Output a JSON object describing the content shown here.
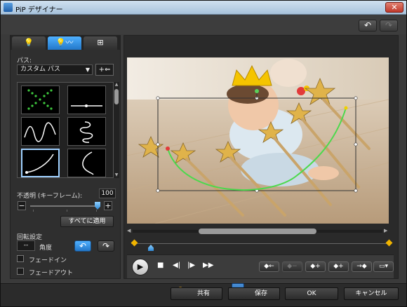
{
  "window": {
    "title": "PiP デザイナー",
    "close_glyph": "✕"
  },
  "toolbar": {
    "undo_glyph": "↶",
    "redo_glyph": "↷"
  },
  "tabs": [
    {
      "icon": "lightbulb-icon",
      "glyph": "💡"
    },
    {
      "icon": "motion-path-icon",
      "glyph": "💡〰"
    },
    {
      "icon": "grid-icon",
      "glyph": "⊞"
    }
  ],
  "path": {
    "label": "パス:",
    "selected": "カスタム パス",
    "add_glyph": "+⇐"
  },
  "opacity": {
    "label": "不透明 (キーフレーム):",
    "value": "100",
    "minus": "−",
    "plus": "+",
    "level": 1.0
  },
  "apply_all": "すべてに適用",
  "rotation": {
    "label": "回転設定",
    "value": "--",
    "unit": "角度",
    "ccw_glyph": "↶",
    "cw_glyph": "↷"
  },
  "fade_in": {
    "label": "フェードイン",
    "checked": false
  },
  "fade_out": {
    "label": "フェードアウト",
    "checked": false
  },
  "playback": {
    "play_glyph": "▶",
    "stop_glyph": "■",
    "prev_frame_glyph": "◀|",
    "next_frame_glyph": "|▶",
    "fast_forward_glyph": "▶▶"
  },
  "keyframe_buttons": [
    {
      "glyph": "◆←",
      "enabled": true
    },
    {
      "glyph": "◆−",
      "enabled": false
    },
    {
      "glyph": "◆+",
      "enabled": true
    },
    {
      "glyph": "◆+",
      "enabled": true
    },
    {
      "glyph": "→◆",
      "enabled": true
    },
    {
      "glyph": "▭▾",
      "enabled": true
    }
  ],
  "bottom": {
    "share": "共有",
    "save": "保存",
    "ok": "OK",
    "cancel": "キャンセル"
  },
  "colors": {
    "accent": "#2e88d6",
    "path_green": "#4cd94c",
    "keyframe": "#f0b400"
  }
}
